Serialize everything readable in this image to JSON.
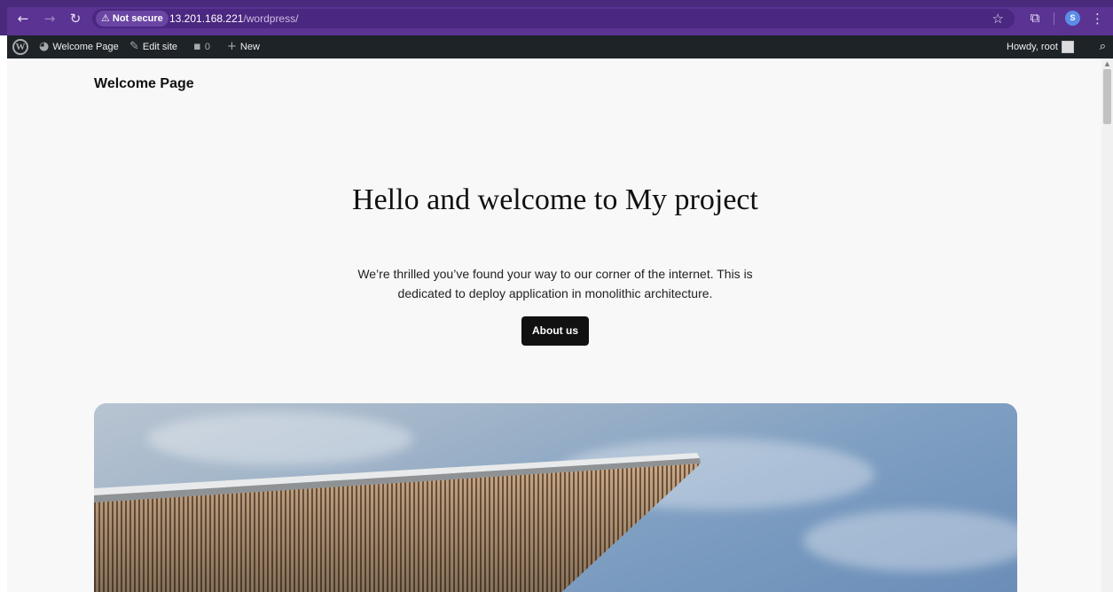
{
  "browser": {
    "security_label": "Not secure",
    "url_host": "13.201.168.221",
    "url_path": "/wordpress/",
    "profile_initial": "S",
    "icons": [
      "back-icon",
      "forward-icon",
      "reload-icon",
      "warning-icon",
      "star-icon",
      "extensions-icon",
      "more-icon"
    ]
  },
  "adminbar": {
    "site_name": "Welcome Page",
    "edit_site": "Edit site",
    "comments_count": "0",
    "new_label": "New",
    "howdy": "Howdy, root"
  },
  "page": {
    "site_title": "Welcome Page",
    "hero_title": "Hello and welcome to My project",
    "hero_text": "We’re thrilled you’ve found your way to our corner of the internet. This is dedicated to deploy application in monolithic architecture.",
    "cta_label": "About us"
  },
  "colors": {
    "chrome": "#4a2a7c",
    "adminbar": "#1d2327",
    "page_bg": "#f8f8f8",
    "button": "#111111"
  }
}
